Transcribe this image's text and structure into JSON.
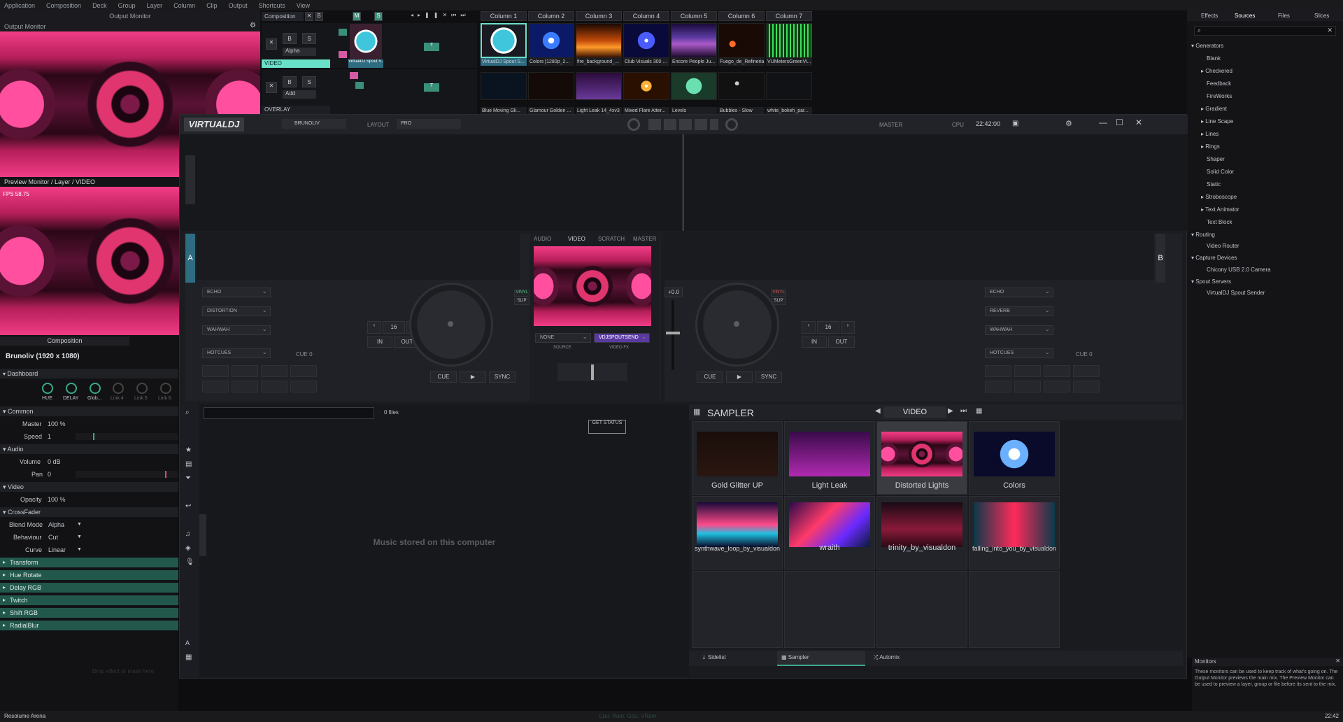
{
  "menu": [
    "Application",
    "Composition",
    "Deck",
    "Group",
    "Layer",
    "Column",
    "Clip",
    "Output",
    "Shortcuts",
    "View"
  ],
  "output_monitor": {
    "header": "Output Monitor",
    "title": "Output Monitor"
  },
  "preview_monitor": {
    "title": "Preview Monitor / Layer / VIDEO",
    "fps": "FPS 58.75"
  },
  "composition_panel": {
    "tab": "Composition",
    "name": "Brunoliv (1920 x 1080)",
    "dashboard": "Dashboard",
    "knobs": [
      "HUE",
      "DELAY",
      "Glob...",
      "Link 4",
      "Link 5",
      "Link 6"
    ],
    "common": "Common",
    "master_label": "Master",
    "master_value": "100 %",
    "speed_label": "Speed",
    "speed_value": "1",
    "audio": "Audio",
    "volume_label": "Volume",
    "volume_value": "0 dB",
    "pan_label": "Pan",
    "pan_value": "0",
    "video": "Video",
    "opacity_label": "Opacity",
    "opacity_value": "100 %",
    "crossfader": "CrossFader",
    "blend_label": "Blend Mode",
    "blend_value": "Alpha",
    "behaviour_label": "Behaviour",
    "behaviour_value": "Cut",
    "curve_label": "Curve",
    "curve_value": "Linear",
    "effects": [
      "Transform",
      "Hue Rotate",
      "Delay RGB",
      "Twitch",
      "Shift RGB",
      "RadialBlur"
    ],
    "drop_hint": "Drop effect or mask here"
  },
  "deck": {
    "composition": "Composition",
    "layer1": {
      "blend": "Alpha",
      "name": "VIDEO",
      "clip": "VirtualDJ Spout S..."
    },
    "layer2": {
      "blend": "Add",
      "name": "OVERLAY"
    },
    "columns": [
      "Column 1",
      "Column 2",
      "Column 3",
      "Column 4",
      "Column 5",
      "Column 6",
      "Column 7"
    ],
    "row1": [
      "VirtualDJ Spout S...",
      "Colors [1280p_2...",
      "fire_background_...",
      "Club Visuals 300 ...",
      "Encore People Ju...",
      "Fuego_de_Refineria",
      "VUMetersGreenVi..."
    ],
    "row2": [
      "Blue Moving Gli...",
      "Glamour Golden ...",
      "Light Leak 14_4xv3",
      "Mixed Flare Atter...",
      "Levels",
      "Bubbles - Slow",
      "white_bokeh_par..."
    ]
  },
  "vdj": {
    "logo": "VIRTUALDJ",
    "user": "BRUNOLIV",
    "layout_label": "LAYOUT",
    "layout_value": "PRO",
    "master_label": "MASTER",
    "cpu_label": "CPU",
    "time": "22:42:00",
    "center_tabs": [
      "AUDIO",
      "VIDEO",
      "SCRATCH",
      "MASTER"
    ],
    "deck_a": "A",
    "deck_b": "B",
    "left_fx": [
      "ECHO",
      "DISTORTION",
      "WAHWAH"
    ],
    "right_fx": [
      "ECHO",
      "REVERB",
      "WAHWAH"
    ],
    "hotcues": "HOTCUES",
    "cue0": "CUE 0",
    "loop": "16",
    "in": "IN",
    "out": "OUT",
    "cue": "CUE",
    "sync": "SYNC",
    "pitch": "+0.0",
    "vinyl": "VINYL",
    "slip": "SLIP",
    "source_value": "NONE",
    "source_label": "SOURCE",
    "videofx_value": "VDJSPOUTSEND",
    "videofx_label": "VIDEO FX",
    "side_labels": {
      "fx": "FX",
      "user": "USER",
      "pads": "PADS",
      "loop": "LOOP"
    },
    "browser": {
      "files": "0 files",
      "status": "GET STATUS",
      "empty": "Music stored on this computer",
      "folders": "folders",
      "sideview": "sideview",
      "info": "info"
    },
    "sampler": {
      "title": "SAMPLER",
      "mode": "VIDEO",
      "items": [
        "Gold Glitter UP",
        "Light Leak",
        "Distorted Lights",
        "Colors",
        "synthwave_loop_by_visualdon",
        "wraith",
        "trinity_by_visualdon",
        "falling_into_you_by_visualdon"
      ]
    },
    "bottom_tabs": [
      "Sidelist",
      "Sampler",
      "Automix"
    ]
  },
  "sources": {
    "tabs": [
      "Effects",
      "Sources",
      "Files",
      "Slices"
    ],
    "search_placeholder": "",
    "generators": "Generators",
    "gen_items": [
      "Blank",
      "Checkered",
      "Feedback",
      "FireWorks",
      "Gradient",
      "Line Scape",
      "Lines",
      "Rings",
      "Shaper",
      "Solid Color",
      "Static",
      "Stroboscope",
      "Text Animator",
      "Text Block"
    ],
    "routing": "Routing",
    "routing_items": [
      "Video Router"
    ],
    "capture": "Capture Devices",
    "capture_items": [
      "Chicony USB 2.0 Camera"
    ],
    "spout": "Spout Servers",
    "spout_items": [
      "VirtualDJ Spout Sender"
    ]
  },
  "monitors": {
    "title": "Monitors",
    "text": "These monitors can be used to keep track of what's going on. The Output Monitor previews the main mix. The Preview Monitor can be used to preview a layer, group or file before its sent to the mix."
  },
  "status": {
    "app": "Resolume Arena",
    "metrics": "Cpu: Ram: Gpu: VRam:",
    "time": "22:42"
  }
}
